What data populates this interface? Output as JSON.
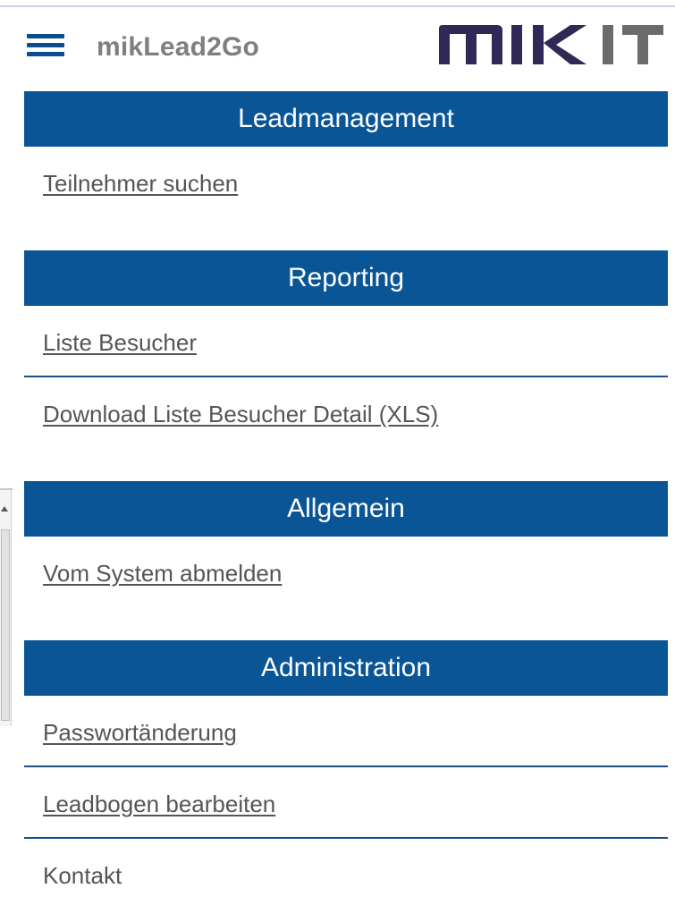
{
  "header": {
    "app_title": "mikLead2Go",
    "logo_text": "MIK IT",
    "menu_icon": "hamburger-menu-icon"
  },
  "colors": {
    "section_bg": "#0a5596",
    "section_text": "#ffffff",
    "link_text": "#555555",
    "divider": "#1b4f84",
    "title_text": "#7f7f7f",
    "logo_dark": "#2e2a55",
    "logo_light": "#6b6b6b"
  },
  "sections": [
    {
      "title": "Leadmanagement",
      "items": [
        {
          "label": "Teilnehmer suchen"
        }
      ]
    },
    {
      "title": "Reporting",
      "items": [
        {
          "label": "Liste Besucher"
        },
        {
          "label": "Download Liste Besucher Detail (XLS)"
        }
      ]
    },
    {
      "title": "Allgemein",
      "items": [
        {
          "label": "Vom System abmelden"
        }
      ]
    },
    {
      "title": "Administration",
      "items": [
        {
          "label": "Passwortänderung"
        },
        {
          "label": "Leadbogen bearbeiten"
        },
        {
          "label": "Kontakt"
        }
      ]
    }
  ]
}
